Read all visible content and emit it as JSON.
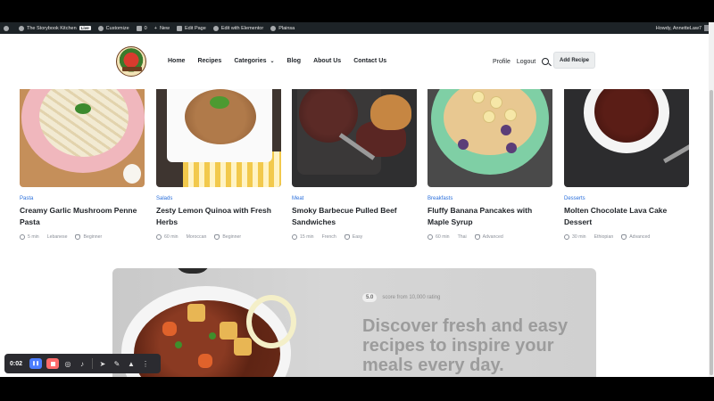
{
  "adminbar": {
    "site_name": "The Storybook Kitchen",
    "live_badge": "Live",
    "customize": "Customize",
    "comments_count": "0",
    "new": "New",
    "edit_page": "Edit Page",
    "edit_elementor": "Edit with Elementor",
    "plugin": "Plainsa",
    "greeting": "Howdy, AnnetteLaw7"
  },
  "header": {
    "nav": [
      "Home",
      "Recipes",
      "Categories",
      "Blog",
      "About Us",
      "Contact Us"
    ],
    "profile": "Profile",
    "logout": "Logout",
    "add_recipe": "Add Recipe"
  },
  "recipes": [
    {
      "category": "Pasta",
      "title": "Creamy Garlic Mushroom Penne Pasta",
      "time": "5 min",
      "cuisine": "Lebanese",
      "level": "Beginner"
    },
    {
      "category": "Salads",
      "title": "Zesty Lemon Quinoa with Fresh Herbs",
      "time": "60 min",
      "cuisine": "Moroccan",
      "level": "Beginner"
    },
    {
      "category": "Meat",
      "title": "Smoky Barbecue Pulled Beef Sandwiches",
      "time": "15 min",
      "cuisine": "French",
      "level": "Easy"
    },
    {
      "category": "Breakfasts",
      "title": "Fluffy Banana Pancakes with Maple Syrup",
      "time": "60 min",
      "cuisine": "Thai",
      "level": "Advanced"
    },
    {
      "category": "Desserts",
      "title": "Molten Chocolate Lava Cake Dessert",
      "time": "30 min",
      "cuisine": "Ethiopian",
      "level": "Advanced"
    }
  ],
  "hero": {
    "score": "5.0",
    "rating_text": "score from 10,000 rating",
    "headline": "Discover fresh and easy recipes to inspire your meals every day."
  },
  "recorder": {
    "time": "0:02"
  },
  "colors": {
    "adminbar_bg": "#1d2327",
    "category_link": "#2a6fdb",
    "recorder_pause": "#4c7dff",
    "recorder_stop": "#ff6b6b"
  }
}
